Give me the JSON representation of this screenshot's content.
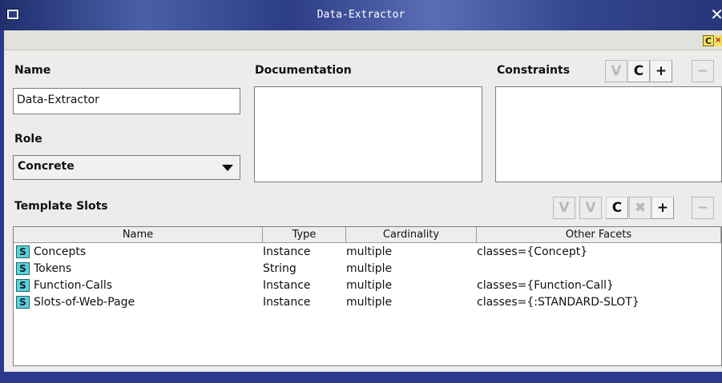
{
  "window": {
    "title": "Data-Extractor",
    "close_glyph": "✕",
    "system_icon": "window-menu-icon"
  },
  "topstrip": {
    "badge": "C",
    "badge2": "×"
  },
  "name": {
    "label": "Name",
    "value": "Data-Extractor"
  },
  "role": {
    "label": "Role",
    "value": "Concrete"
  },
  "documentation": {
    "label": "Documentation",
    "value": ""
  },
  "constraints": {
    "label": "Constraints",
    "buttons": [
      {
        "glyph": "V",
        "icon": "view-icon",
        "disabled": true
      },
      {
        "glyph": "C",
        "icon": "create-icon",
        "disabled": false
      },
      {
        "glyph": "+",
        "icon": "add-icon",
        "disabled": false
      },
      {
        "glyph": "−",
        "icon": "remove-icon",
        "disabled": true
      }
    ]
  },
  "template_slots": {
    "label": "Template Slots",
    "buttons": [
      {
        "glyph": "V",
        "icon": "view-slot-icon",
        "disabled": true
      },
      {
        "glyph": "V",
        "icon": "view-slot-at-class-icon",
        "disabled": true
      },
      {
        "glyph": "C",
        "icon": "create-slot-icon",
        "disabled": false
      },
      {
        "glyph": "✖",
        "icon": "delete-slot-icon",
        "disabled": true
      },
      {
        "glyph": "+",
        "icon": "add-slot-icon",
        "disabled": false
      },
      {
        "glyph": "−",
        "icon": "remove-slot-icon",
        "disabled": true
      }
    ],
    "columns": [
      "Name",
      "Type",
      "Cardinality",
      "Other Facets"
    ],
    "rows": [
      {
        "icon": "S",
        "name": "Concepts",
        "type": "Instance",
        "cardinality": "multiple",
        "facets": "classes={Concept}"
      },
      {
        "icon": "S",
        "name": "Tokens",
        "type": "String",
        "cardinality": "multiple",
        "facets": ""
      },
      {
        "icon": "S",
        "name": "Function-Calls",
        "type": "Instance",
        "cardinality": "multiple",
        "facets": "classes={Function-Call}"
      },
      {
        "icon": "S",
        "name": "Slots-of-Web-Page",
        "type": "Instance",
        "cardinality": "multiple",
        "facets": "classes={:STANDARD-SLOT}"
      }
    ]
  }
}
